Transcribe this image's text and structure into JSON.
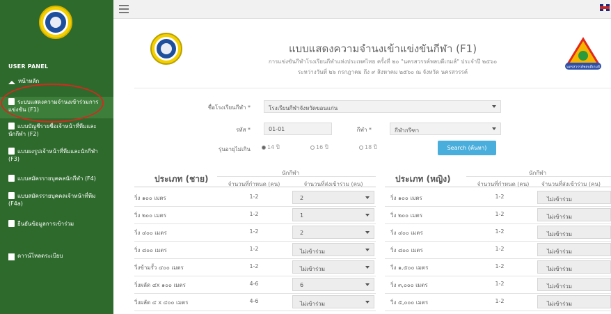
{
  "sidebar": {
    "panel_title": "USER PANEL",
    "items": [
      {
        "label": "หน้าหลัก",
        "icon": "home-icon"
      },
      {
        "label": "ระบบแสดงความจำนงเข้าร่วมการแข่งขัน (F1)",
        "icon": "file-icon"
      },
      {
        "label": "แบบบัญชีรายชื่อเจ้าหน้าที่ทีมและนักกีฬา (F2)",
        "icon": "file-icon"
      },
      {
        "label": "แบบผงรูปเจ้าหน้าที่ทีมและนักกีฬา (F3)",
        "icon": "file-icon"
      },
      {
        "label": "แบบสมัครรายบุคคลนักกีฬา (F4)",
        "icon": "file-icon"
      },
      {
        "label": "แบบสมัครรายบุคคลเจ้าหน้าที่ทีม (F4a)",
        "icon": "file-icon"
      },
      {
        "label": "ยืนยันข้อมูลการเข้าร่วม",
        "icon": "file-icon"
      },
      {
        "label": "ดาวน์โหลดระเบียบ",
        "icon": "download-icon"
      }
    ]
  },
  "header": {
    "title": "แบบแสดงความจำนงเข้าแข่งขันกีฬา (F1)",
    "subtitle1": "การแข่งขันกีฬาโรงเรียนกีฬาแห่งประเทศไทย ครั้งที่ ๒๐ \"นครสวรรค์พลบดีเกมส์\" ประจำปี ๒๕๖๐",
    "subtitle2": "ระหว่างวันที่ ๒๖ กรกฎาคม ถึง ๙ สิงหาคม ๒๕๖๐ ณ จังหวัด นครสวรรค์",
    "event_logo_text": "นครสวรรค์พลบดีเกมส์"
  },
  "form": {
    "school_label": "ชื่อโรงเรียนกีฬา *",
    "school_value": "โรงเรียนกีฬาจังหวัดขอนแก่น",
    "code_label": "รหัส *",
    "code_value": "01-01",
    "sport_label": "กีฬา *",
    "sport_value": "กีฬากรีฑา",
    "age_label": "รุ่นอายุไม่เกิน",
    "age_options": [
      "14 ปี",
      "16 ปี",
      "18 ปี"
    ],
    "search_label": "Search (ค้นหา)"
  },
  "table_male": {
    "category": "ประเภท (ชาย)",
    "group_header": "นักกีฬา",
    "col_required": "จำนวนที่กำหนด (คน)",
    "col_entered": "จำนวนที่ส่งเข้าร่วม (คน)",
    "rows": [
      {
        "event": "วิ่ง ๑๐๐ เมตร",
        "required": "1-2",
        "entered": "2"
      },
      {
        "event": "วิ่ง ๒๐๐ เมตร",
        "required": "1-2",
        "entered": "1"
      },
      {
        "event": "วิ่ง ๔๐๐ เมตร",
        "required": "1-2",
        "entered": "2"
      },
      {
        "event": "วิ่ง ๘๐๐ เมตร",
        "required": "1-2",
        "entered": "ไม่เข้าร่วม"
      },
      {
        "event": "วิ่งข้ามรั้ว ๔๐๐ เมตร",
        "required": "1-2",
        "entered": "ไม่เข้าร่วม"
      },
      {
        "event": "วิ่งผลัด ๔x ๑๐๐ เมตร",
        "required": "4-6",
        "entered": "6"
      },
      {
        "event": "วิ่งผลัด ๔ x ๔๐๐ เมตร",
        "required": "4-6",
        "entered": "ไม่เข้าร่วม"
      }
    ]
  },
  "table_female": {
    "category": "ประเภท (หญิง)",
    "group_header": "นักกีฬา",
    "col_required": "จำนวนที่กำหนด (คน)",
    "col_entered": "จำนวนที่ส่งเข้าร่วม (คน)",
    "rows": [
      {
        "event": "วิ่ง ๑๐๐ เมตร",
        "required": "1-2",
        "entered": "ไม่เข้าร่วม"
      },
      {
        "event": "วิ่ง ๒๐๐ เมตร",
        "required": "1-2",
        "entered": "ไม่เข้าร่วม"
      },
      {
        "event": "วิ่ง ๔๐๐ เมตร",
        "required": "1-2",
        "entered": "ไม่เข้าร่วม"
      },
      {
        "event": "วิ่ง ๘๐๐ เมตร",
        "required": "1-2",
        "entered": "ไม่เข้าร่วม"
      },
      {
        "event": "วิ่ง ๑,๕๐๐ เมตร",
        "required": "1-2",
        "entered": "ไม่เข้าร่วม"
      },
      {
        "event": "วิ่ง ๓,๐๐๐ เมตร",
        "required": "1-2",
        "entered": "ไม่เข้าร่วม"
      },
      {
        "event": "วิ่ง ๕,๐๐๐ เมตร",
        "required": "1-2",
        "entered": "ไม่เข้าร่วม"
      }
    ]
  },
  "colors": {
    "sidebar": "#2d6a2c",
    "accent_button": "#4aaedc",
    "highlight_circle": "#d7281e"
  }
}
